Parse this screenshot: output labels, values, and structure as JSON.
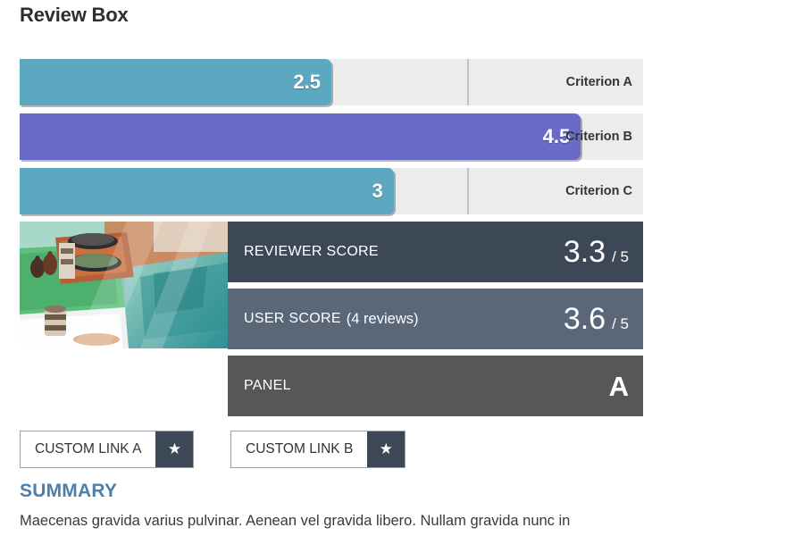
{
  "page": {
    "title": "Review Box"
  },
  "criteria": {
    "divider_color": "#c0c3c6",
    "track_color": "#ececec",
    "items": [
      {
        "label": "Criterion A",
        "score": "2.5",
        "max": 5,
        "percent": 50,
        "color": "#5ca8c0"
      },
      {
        "label": "Criterion B",
        "score": "4.5",
        "max": 5,
        "percent": 90,
        "color": "#6a6bc8"
      },
      {
        "label": "Criterion C",
        "score": "3",
        "max": 5,
        "percent": 60,
        "color": "#5ca8c0"
      }
    ]
  },
  "score_panel": {
    "thumbnail_alt": "review-thumbnail-photo",
    "bands": [
      {
        "name": "reviewer-score",
        "label": "REVIEWER SCORE",
        "sub": "",
        "value": "3.3",
        "denominator": "/ 5",
        "grade": "",
        "bg": "#3c4856"
      },
      {
        "name": "user-score",
        "label": "USER SCORE",
        "sub": "(4 reviews)",
        "value": "3.6",
        "denominator": "/ 5",
        "grade": "",
        "bg": "#5a6779"
      },
      {
        "name": "panel-grade",
        "label": "PANEL",
        "sub": "",
        "value": "",
        "denominator": "",
        "grade": "A",
        "bg": "#575757"
      }
    ]
  },
  "custom_links": [
    {
      "label": "CUSTOM LINK A",
      "icon": "star-icon",
      "glyph": "★"
    },
    {
      "label": "CUSTOM LINK B",
      "icon": "star-icon",
      "glyph": "★"
    }
  ],
  "summary": {
    "heading": "SUMMARY",
    "heading_color": "#4e7eab",
    "body": "Maecenas gravida varius pulvinar. Aenean vel gravida libero. Nullam gravida nunc in"
  }
}
